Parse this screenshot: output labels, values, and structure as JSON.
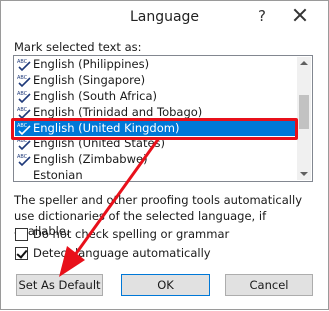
{
  "window": {
    "title": "Language",
    "help_glyph": "?"
  },
  "list_label": "Mark selected text as:",
  "languages": [
    {
      "label": "English (Philippines)",
      "icon": "spelling-check-icon"
    },
    {
      "label": "English (Singapore)",
      "icon": "spelling-check-icon"
    },
    {
      "label": "English (South Africa)",
      "icon": "spelling-check-icon"
    },
    {
      "label": "English (Trinidad and Tobago)",
      "icon": "spelling-check-icon"
    },
    {
      "label": "English (United Kingdom)",
      "icon": "spelling-check-icon",
      "selected": true
    },
    {
      "label": "English (United States)",
      "icon": "spelling-check-icon"
    },
    {
      "label": "English (Zimbabwe)",
      "icon": "spelling-check-icon"
    },
    {
      "label": "Estonian",
      "icon": null
    }
  ],
  "description": "The speller and other proofing tools automatically use dictionaries of the selected language, if available.",
  "options": {
    "no_spell_check": {
      "label": "Do not check spelling or grammar",
      "checked": false
    },
    "detect_language": {
      "label": "Detect language automatically",
      "checked": true
    }
  },
  "buttons": {
    "set_default": "Set As Default",
    "ok": "OK",
    "cancel": "Cancel"
  },
  "colors": {
    "selection": "#0078d7",
    "annotation_red": "#e8101a"
  }
}
